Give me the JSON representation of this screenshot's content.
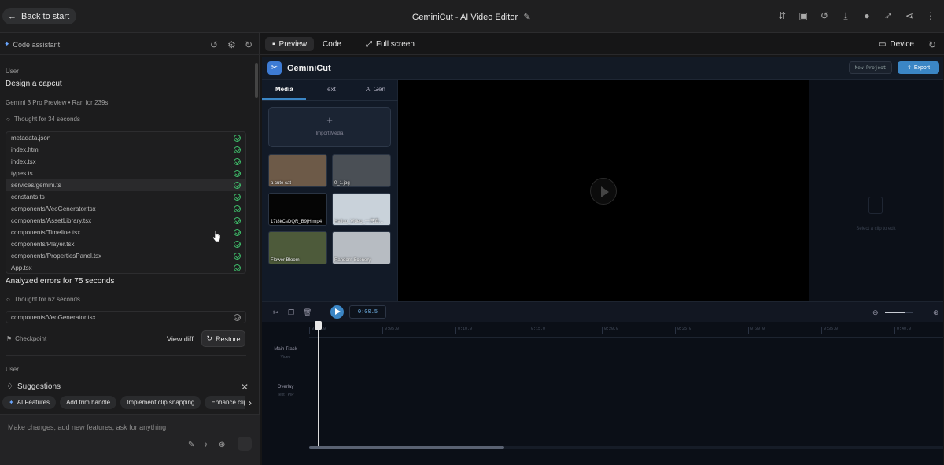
{
  "topbar": {
    "back_label": "Back to start",
    "title": "GeminiCut - AI Video Editor",
    "icons": [
      "translate-icon",
      "save-icon",
      "history-icon",
      "download-icon",
      "github-icon",
      "deploy-rocket-icon",
      "share-icon",
      "more-icon"
    ]
  },
  "left": {
    "header_label": "Code assistant",
    "user_label": "User",
    "user_message": "Design a capcut",
    "model_line": "Gemini 3 Pro Preview  •  Ran for 239s",
    "thought1": "Thought for 34 seconds",
    "files": [
      "metadata.json",
      "index.html",
      "index.tsx",
      "types.ts",
      "services/gemini.ts",
      "constants.ts",
      "components/VeoGenerator.tsx",
      "components/AssetLibrary.tsx",
      "components/Timeline.tsx",
      "components/Player.tsx",
      "components/PropertiesPanel.tsx",
      "App.tsx"
    ],
    "analyzed": "Analyzed errors for 75 seconds",
    "thought2": "Thought for 62 seconds",
    "fixed_file": "components/VeoGenerator.tsx",
    "checkpoint": "Checkpoint",
    "view_diff": "View diff",
    "restore": "Restore",
    "user_label2": "User",
    "suggestions_title": "Suggestions",
    "chips": [
      "AI Features",
      "Add trim handle",
      "Implement clip snapping",
      "Enhance clip"
    ],
    "input_placeholder": "Make changes, add new features, ask for anything"
  },
  "right": {
    "tabs": [
      "Preview",
      "Code",
      "Full screen"
    ],
    "device": "Device"
  },
  "app": {
    "name": "GeminiCut",
    "new_project": "New Project",
    "export": "Export",
    "media_tabs": [
      "Media",
      "Text",
      "AI Gen"
    ],
    "import_media": "Import Media",
    "thumbs": [
      {
        "caption": "a cute cat",
        "color": "#6d5a48"
      },
      {
        "caption": "0_1.jpg",
        "color": "#4a4f55"
      },
      {
        "caption": "17t8kCsDQR_B9jH.mp4",
        "color": "#050505"
      },
      {
        "caption": "Hailuo_Video_一只真...",
        "color": "#c9d2da"
      },
      {
        "caption": "Flower Bloom",
        "color": "#4d5a3a"
      },
      {
        "caption": "Random Scenery",
        "color": "#b7bcc2"
      }
    ],
    "select_clip": "Select a clip to edit",
    "timecode": "0:00.5",
    "ruler_ticks": [
      "0:00.0",
      "0:05.0",
      "0:10.0",
      "0:15.0",
      "0:20.0",
      "0:25.0",
      "0:30.0",
      "0:35.0",
      "0:40.0"
    ],
    "tracks": [
      {
        "name": "Main Track",
        "sub": "Video"
      },
      {
        "name": "Overlay",
        "sub": "Text / PiP"
      }
    ]
  }
}
